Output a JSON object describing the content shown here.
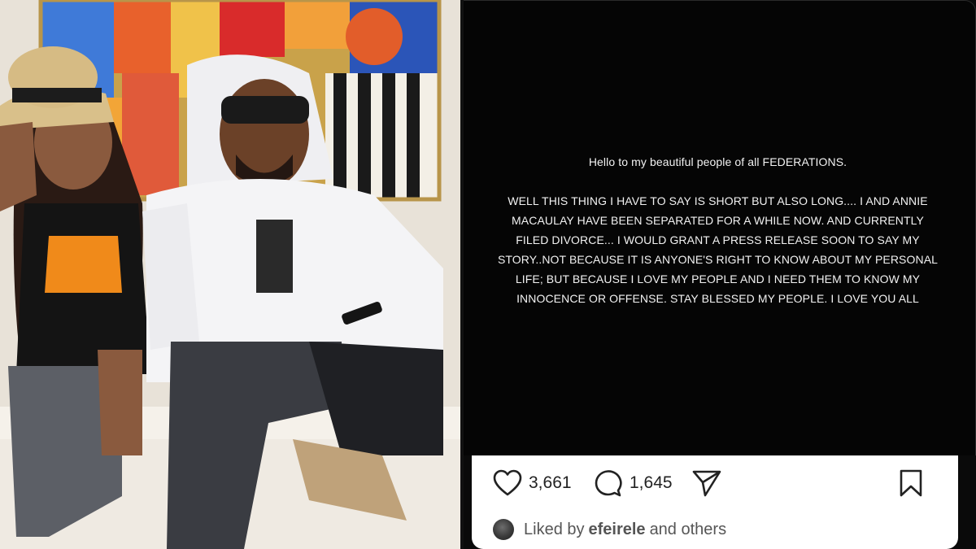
{
  "story": {
    "greeting": "Hello to my beautiful people of all FEDERATIONS.",
    "body": "WELL THIS THING I HAVE TO SAY IS SHORT BUT ALSO LONG.... I AND ANNIE MACAULAY HAVE BEEN SEPARATED FOR A WHILE NOW. AND CURRENTLY FILED DIVORCE... I WOULD GRANT A PRESS RELEASE SOON TO SAY MY STORY..NOT BECAUSE IT IS ANYONE'S RIGHT TO KNOW ABOUT MY PERSONAL LIFE; BUT BECAUSE I LOVE MY PEOPLE AND I NEED THEM TO KNOW MY INNOCENCE OR OFFENSE. STAY BLESSED MY PEOPLE. I LOVE YOU ALL"
  },
  "actions": {
    "likes": "3,661",
    "comments": "1,645",
    "like_icon": "heart-icon",
    "comment_icon": "comment-bubble-icon",
    "share_icon": "paper-plane-icon",
    "save_icon": "bookmark-icon"
  },
  "liked_by": {
    "prefix": "Liked by",
    "user": "efeirele",
    "suffix": "and others"
  },
  "colors": {
    "story_bg": "#050505",
    "footer_bg": "#ffffff",
    "text": "#f2f2f2"
  }
}
